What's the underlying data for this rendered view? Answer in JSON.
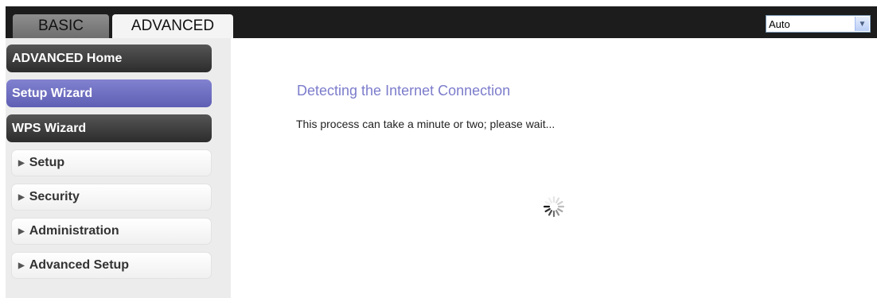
{
  "tabs": {
    "basic_label": "BASIC",
    "advanced_label": "ADVANCED"
  },
  "language_select": {
    "value": "Auto"
  },
  "sidebar": {
    "items": [
      {
        "label": "ADVANCED Home",
        "style": "dark"
      },
      {
        "label": "Setup Wizard",
        "style": "selected"
      },
      {
        "label": "WPS Wizard",
        "style": "dark"
      },
      {
        "label": "Setup",
        "style": "expandable"
      },
      {
        "label": "Security",
        "style": "expandable"
      },
      {
        "label": "Administration",
        "style": "expandable"
      },
      {
        "label": "Advanced Setup",
        "style": "expandable"
      }
    ]
  },
  "main": {
    "title": "Detecting the Internet Connection",
    "description": "This process can take a minute or two; please wait..."
  },
  "icons": {
    "spinner": "loading-spinner-icon",
    "dropdown": "chevron-down-icon",
    "expand": "triangle-right-icon"
  },
  "colors": {
    "topbar": "#1c1c1c",
    "selected_nav": "#6b6bc2",
    "title": "#7c7ccc"
  }
}
